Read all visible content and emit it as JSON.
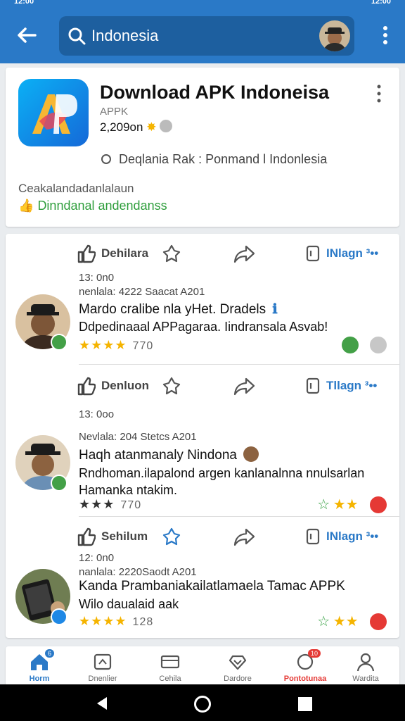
{
  "status_bar": {
    "time": "12:00",
    "system": "12:00"
  },
  "header": {
    "search_text": "Indonesia"
  },
  "app": {
    "title": "Download APK Indoneisa",
    "subtitle": "APPK",
    "rating": "2,209on",
    "location": "Deqlania Rak : Ponmand l Indonlesia",
    "description": "Ceakalandadanlalaun",
    "green_text": "Dinndanal andendanss"
  },
  "posts": [
    {
      "like_label": "Dehilara",
      "msg_label": "INlagn ³••",
      "meta_time": "13: 0n0",
      "meta_source": "nenlala: 4222 Saacat A201",
      "title": "Mardo cralibe nla yHet. Dradels",
      "body": "Ddpedinaaal APPagaraa. Iindransala Asvab!",
      "stars": "★★★★",
      "count": "770",
      "verified_color": "#43a047",
      "badge_colors": [
        "#43a047",
        "#c7c7c7"
      ]
    },
    {
      "like_label": "Denluon",
      "msg_label": "Tllagn ³••",
      "meta_time": "13: 0oo",
      "meta_source": "Nevlala: 204 Stetcs A201",
      "title": "Haqh atanmanaly Nindona",
      "body": "Rndhoman.ilapalond argen kanlanalnna nnulsarlan Hamanka ntakim.",
      "stars": "★★★",
      "count": "770",
      "verified_color": "#43a047",
      "badge_colors": [
        "#e53935"
      ]
    },
    {
      "like_label": "Sehilum",
      "msg_label": "INlagn ³••",
      "meta_time": "12: 0n0",
      "meta_source": "nanlala: 2220Saodt A201",
      "title": "Kanda Prambaniakailatlamaela Tamac APPK",
      "body": "Wilo daualaid aak",
      "stars": "★★★★",
      "count": "128",
      "verified_color": "#1e88e5",
      "badge_colors": [
        "#e53935"
      ]
    }
  ],
  "bottom_nav": [
    {
      "label": "Horm",
      "badge": "6"
    },
    {
      "label": "Dnenlier",
      "badge": ""
    },
    {
      "label": "Cehila",
      "badge": ""
    },
    {
      "label": "Dardore",
      "badge": ""
    },
    {
      "label": "Pontotunaa",
      "badge": "10"
    },
    {
      "label": "Wardita",
      "badge": ""
    }
  ],
  "colors": {
    "primary": "#2a79c7",
    "active_nav": "#e53935",
    "star": "#f5b400",
    "green": "#2f9e3c"
  }
}
